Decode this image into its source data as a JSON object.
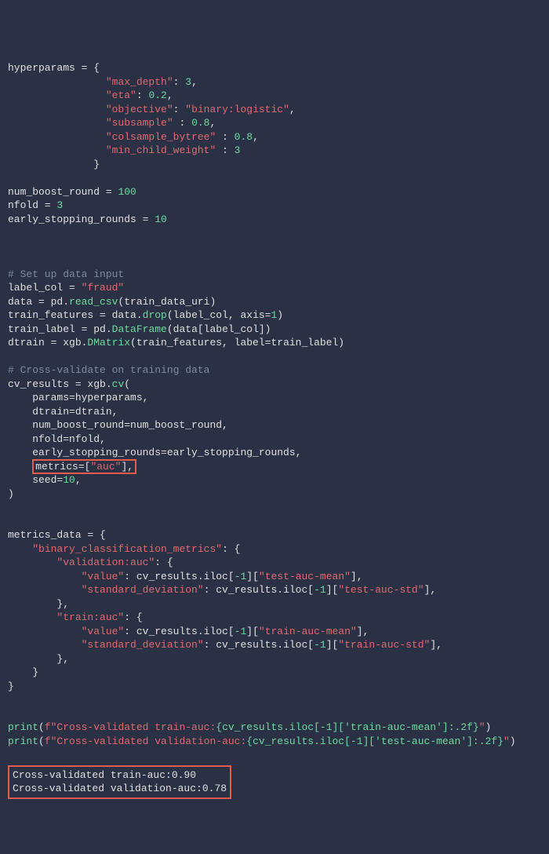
{
  "code": {
    "l1_a": "hyperparams ",
    "l1_b": "= {",
    "l2_a": "                ",
    "l2_b": "\"max_depth\"",
    "l2_c": ": ",
    "l2_d": "3",
    "l2_e": ",",
    "l3_a": "                ",
    "l3_b": "\"eta\"",
    "l3_c": ": ",
    "l3_d": "0.2",
    "l3_e": ",",
    "l4_a": "                ",
    "l4_b": "\"objective\"",
    "l4_c": ": ",
    "l4_d": "\"binary:logistic\"",
    "l4_e": ",",
    "l5_a": "                ",
    "l5_b": "\"subsample\"",
    "l5_c": " : ",
    "l5_d": "0.8",
    "l5_e": ",",
    "l6_a": "                ",
    "l6_b": "\"colsample_bytree\"",
    "l6_c": " : ",
    "l6_d": "0.8",
    "l6_e": ",",
    "l7_a": "                ",
    "l7_b": "\"min_child_weight\"",
    "l7_c": " : ",
    "l7_d": "3",
    "l8_a": "              }",
    "l10_a": "num_boost_round ",
    "l10_b": "= ",
    "l10_c": "100",
    "l11_a": "nfold ",
    "l11_b": "= ",
    "l11_c": "3",
    "l12_a": "early_stopping_rounds ",
    "l12_b": "= ",
    "l12_c": "10",
    "l16_a": "# Set up data input",
    "l17_a": "label_col ",
    "l17_b": "= ",
    "l17_c": "\"fraud\"",
    "l18_a": "data ",
    "l18_b": "= pd.",
    "l18_c": "read_csv",
    "l18_d": "(train_data_uri)",
    "l19_a": "train_features ",
    "l19_b": "= data.",
    "l19_c": "drop",
    "l19_d": "(label_col, axis=",
    "l19_e": "1",
    "l19_f": ")",
    "l20_a": "train_label ",
    "l20_b": "= pd.",
    "l20_c": "DataFrame",
    "l20_d": "(data[label_col])",
    "l21_a": "dtrain ",
    "l21_b": "= xgb.",
    "l21_c": "DMatrix",
    "l21_d": "(train_features, label=train_label)",
    "l23_a": "# Cross-validate on training data",
    "l24_a": "cv_results ",
    "l24_b": "= xgb.",
    "l24_c": "cv",
    "l24_d": "(",
    "l25_a": "    params=hyperparams,",
    "l26_a": "    dtrain=dtrain,",
    "l27_a": "    num_boost_round=num_boost_round,",
    "l28_a": "    nfold=nfold,",
    "l29_a": "    early_stopping_rounds=early_stopping_rounds,",
    "l30_pre": "    ",
    "l30_box_a": "metrics=[",
    "l30_box_b": "\"auc\"",
    "l30_box_c": "],",
    "l31_a": "    seed=",
    "l31_b": "10",
    "l31_c": ",",
    "l32_a": ")",
    "l35_a": "metrics_data ",
    "l35_b": "= {",
    "l36_a": "    ",
    "l36_b": "\"binary_classification_metrics\"",
    "l36_c": ": {",
    "l37_a": "        ",
    "l37_b": "\"validation:auc\"",
    "l37_c": ": {",
    "l38_a": "            ",
    "l38_b": "\"value\"",
    "l38_c": ": cv_results.iloc[",
    "l38_d": "-1",
    "l38_e": "][",
    "l38_f": "\"test-auc-mean\"",
    "l38_g": "],",
    "l39_a": "            ",
    "l39_b": "\"standard_deviation\"",
    "l39_c": ": cv_results.iloc[",
    "l39_d": "-1",
    "l39_e": "][",
    "l39_f": "\"test-auc-std\"",
    "l39_g": "],",
    "l40_a": "        },",
    "l41_a": "        ",
    "l41_b": "\"train:auc\"",
    "l41_c": ": {",
    "l42_a": "            ",
    "l42_b": "\"value\"",
    "l42_c": ": cv_results.iloc[",
    "l42_d": "-1",
    "l42_e": "][",
    "l42_f": "\"train-auc-mean\"",
    "l42_g": "],",
    "l43_a": "            ",
    "l43_b": "\"standard_deviation\"",
    "l43_c": ": cv_results.iloc[",
    "l43_d": "-1",
    "l43_e": "][",
    "l43_f": "\"train-auc-std\"",
    "l43_g": "],",
    "l44_a": "        },",
    "l45_a": "    }",
    "l46_a": "}",
    "l49_a": "print",
    "l49_b": "(",
    "l49_c": "f\"Cross-validated train-auc:",
    "l49_d": "{cv_results.iloc[-1]['train-auc-mean']:.2f}",
    "l49_e": "\"",
    "l49_f": ")",
    "l50_a": "print",
    "l50_b": "(",
    "l50_c": "f\"Cross-validated validation-auc:",
    "l50_d": "{cv_results.iloc[-1]['test-auc-mean']:.2f}",
    "l50_e": "\"",
    "l50_f": ")"
  },
  "output": {
    "line1": "Cross-validated train-auc:0.90",
    "line2": "Cross-validated validation-auc:0.78"
  }
}
